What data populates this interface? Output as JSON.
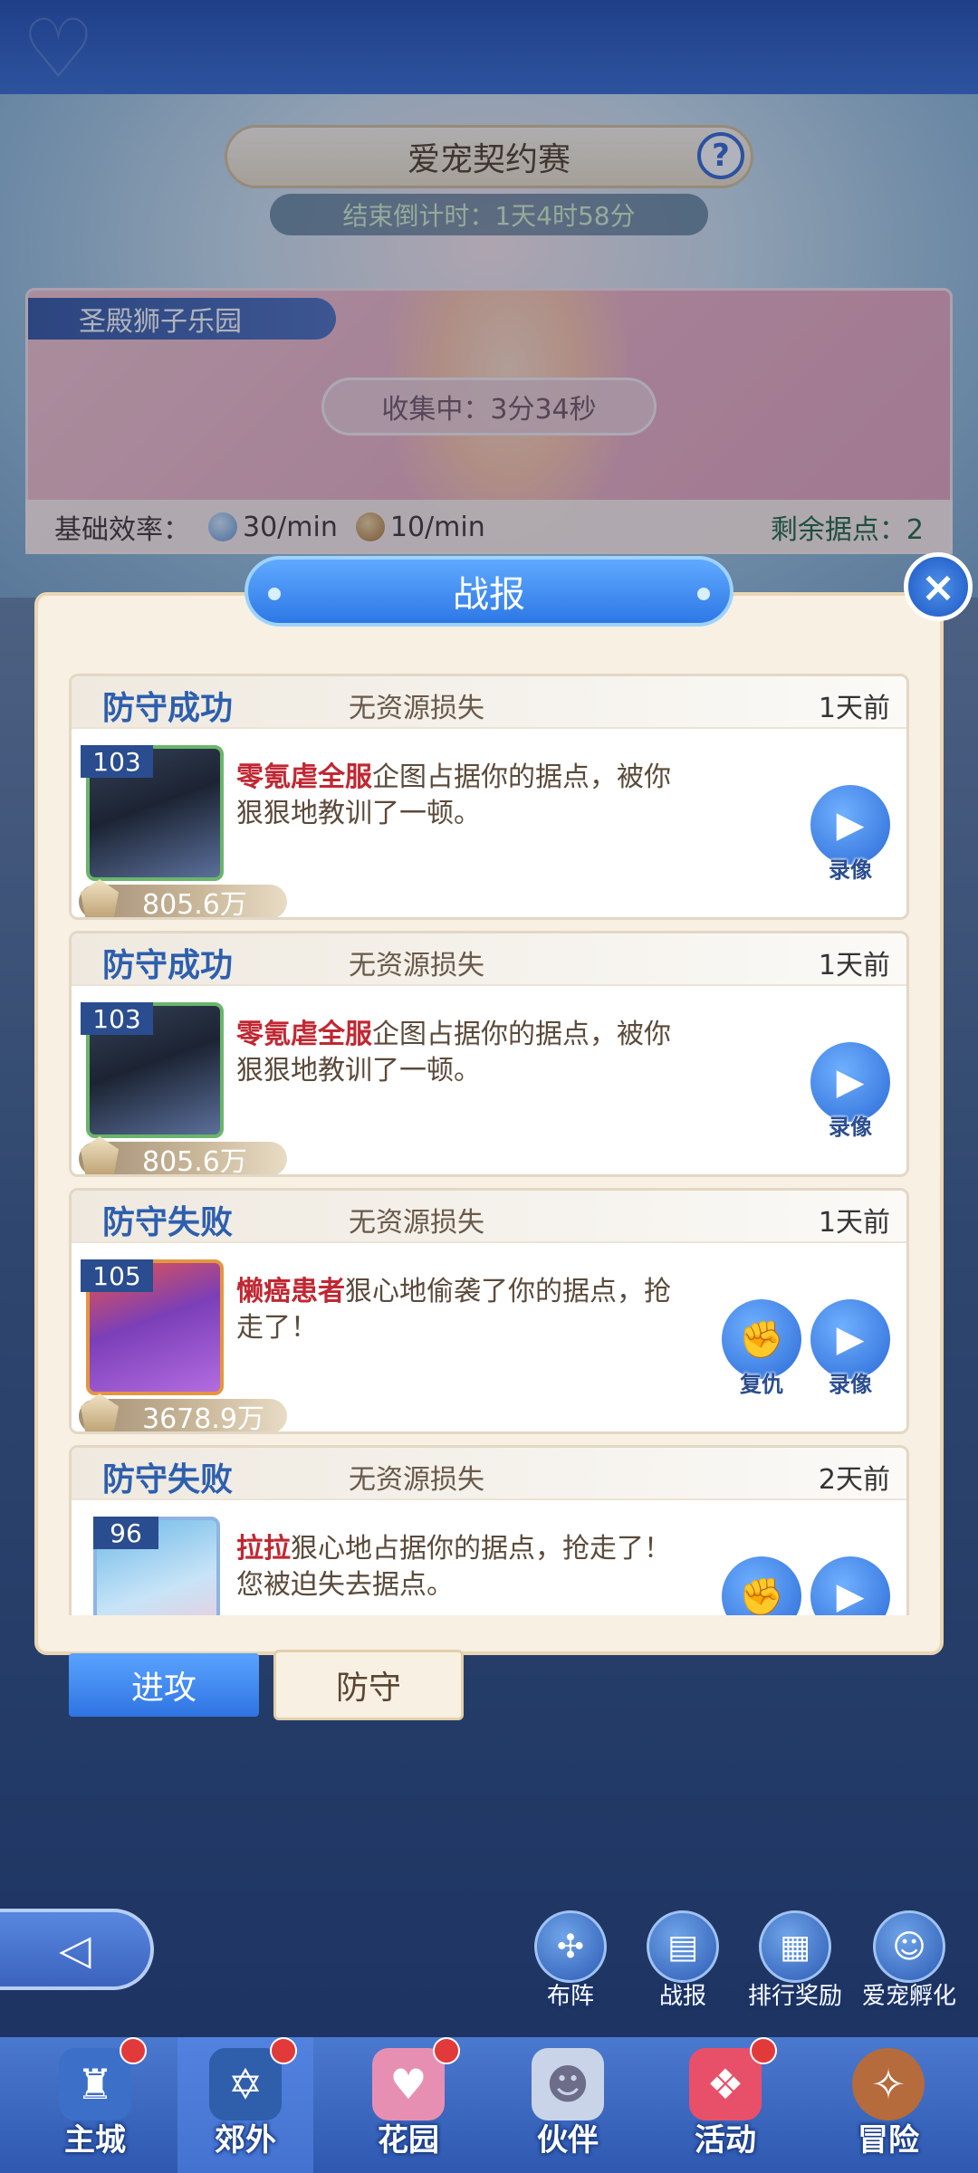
{
  "event": {
    "title": "爱宠契约赛",
    "help_icon": "?",
    "countdown": "结束倒计时：1天4时58分"
  },
  "arena": {
    "name": "圣殿狮子乐园",
    "collecting": "收集中：3分34秒",
    "efficiency_label": "基础效率：",
    "rate_blue": "30/min",
    "rate_brown": "10/min",
    "remaining": "剩余据点：2"
  },
  "modal": {
    "title": "战报",
    "close_icon": "×"
  },
  "reports": [
    {
      "result": "防守成功",
      "loss": "无资源损失",
      "time": "1天前",
      "level": "103",
      "power": "805.6万",
      "player": "零氪虐全服",
      "text": "企图占据你的据点，被你狠狠地教训了一顿。",
      "replay": "录像"
    },
    {
      "result": "防守成功",
      "loss": "无资源损失",
      "time": "1天前",
      "level": "103",
      "power": "805.6万",
      "player": "零氪虐全服",
      "text": "企图占据你的据点，被你狠狠地教训了一顿。",
      "replay": "录像"
    },
    {
      "result": "防守失败",
      "loss": "无资源损失",
      "time": "1天前",
      "level": "105",
      "power": "3678.9万",
      "player": "懒癌患者",
      "text": "狠心地偷袭了你的据点，抢走了！",
      "revenge": "复仇",
      "replay": "录像"
    },
    {
      "result": "防守失败",
      "loss": "无资源损失",
      "time": "2天前",
      "level": "96",
      "player": "拉拉",
      "text": "狠心地占据你的据点，抢走了！您被迫失去据点。"
    }
  ],
  "tabs": {
    "attack": "进攻",
    "defend": "防守"
  },
  "utilities": [
    "布阵",
    "战报",
    "排行奖励",
    "爱宠孵化"
  ],
  "nav": [
    "主城",
    "郊外",
    "花园",
    "伙伴",
    "活动",
    "冒险"
  ],
  "colors": {
    "accent_blue": "#2e78e6",
    "player_name_red": "#c12732",
    "title_blue": "#2d5fae"
  }
}
